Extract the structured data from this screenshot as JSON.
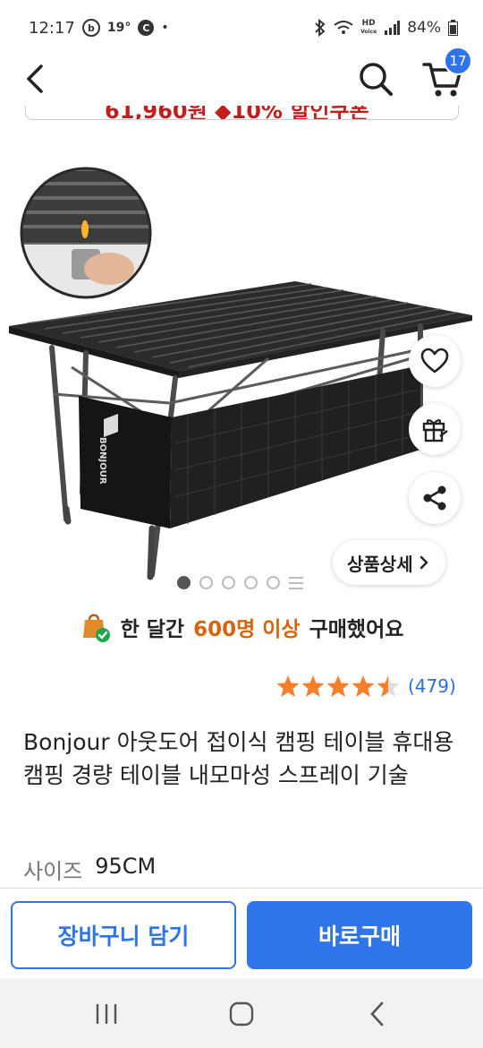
{
  "status_bar": {
    "time": "12:17",
    "b_icon": "b",
    "temp": "19°",
    "c_icon": "C",
    "dot": "•",
    "hd_label": "HD",
    "voice_label": "Voice",
    "battery": "84%"
  },
  "nav": {
    "cart_count": "17"
  },
  "scrolled_price": "61,960원 ◆10% 할인쿠폰",
  "image_brand_mark": "BONJOUR",
  "pager": {
    "total_dots": 5,
    "active_index": 0
  },
  "detail_button": "상품상세",
  "purchase_banner": {
    "prefix": "한 달간",
    "highlight": "600명 이상",
    "suffix": "구매했어요"
  },
  "rating": {
    "stars": 4.5,
    "count": "(479)",
    "color": "#f57f2a"
  },
  "product_title": "Bonjour 아웃도어 접이식 캠핑 테이블 휴대용 캠핑 경량 테이블 내모마성 스프레이 기술",
  "size": {
    "label": "사이즈",
    "value": "95CM"
  },
  "buttons": {
    "add_to_cart": "장바구니 담기",
    "buy_now": "바로구매"
  },
  "colors": {
    "primary": "#2f74e8",
    "highlight": "#d9640e",
    "price_red": "#c21e1e"
  },
  "icons": [
    "back-icon",
    "search-icon",
    "cart-icon",
    "heart-icon",
    "gift-icon",
    "share-icon",
    "chevron-right-icon",
    "shopping-bag-check-icon",
    "star-icon",
    "recent-apps-icon",
    "home-icon",
    "android-back-icon"
  ]
}
